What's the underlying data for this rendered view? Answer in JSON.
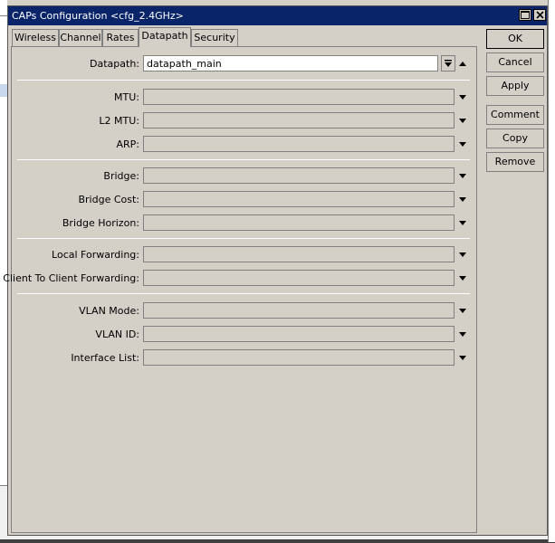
{
  "window": {
    "title": "CAPs Configuration <cfg_2.4GHz>"
  },
  "icons": [
    "maximize-icon",
    "close-icon",
    "dropdown-arrow-icon",
    "dropdown-arrow-up-icon",
    "dropdown-arrow-down-icon"
  ],
  "tabs": [
    {
      "label": "Wireless",
      "active": false
    },
    {
      "label": "Channel",
      "active": false
    },
    {
      "label": "Rates",
      "active": false
    },
    {
      "label": "Datapath",
      "active": true
    },
    {
      "label": "Security",
      "active": false
    }
  ],
  "form": {
    "datapath": {
      "label": "Datapath:",
      "value": "datapath_main"
    },
    "mtu": {
      "label": "MTU:",
      "value": ""
    },
    "l2mtu": {
      "label": "L2 MTU:",
      "value": ""
    },
    "arp": {
      "label": "ARP:",
      "value": ""
    },
    "bridge": {
      "label": "Bridge:",
      "value": ""
    },
    "bridge_cost": {
      "label": "Bridge Cost:",
      "value": ""
    },
    "bridge_horizon": {
      "label": "Bridge Horizon:",
      "value": ""
    },
    "local_forwarding": {
      "label": "Local Forwarding:",
      "value": ""
    },
    "client_to_client": {
      "label": "Client To Client Forwarding:",
      "value": ""
    },
    "vlan_mode": {
      "label": "VLAN Mode:",
      "value": ""
    },
    "vlan_id": {
      "label": "VLAN ID:",
      "value": ""
    },
    "interface_list": {
      "label": "Interface List:",
      "value": ""
    }
  },
  "buttons": {
    "ok": "OK",
    "cancel": "Cancel",
    "apply": "Apply",
    "comment": "Comment",
    "copy": "Copy",
    "remove": "Remove"
  },
  "colors": {
    "titlebar": "#0a246a",
    "window_bg": "#d4d0c8"
  }
}
